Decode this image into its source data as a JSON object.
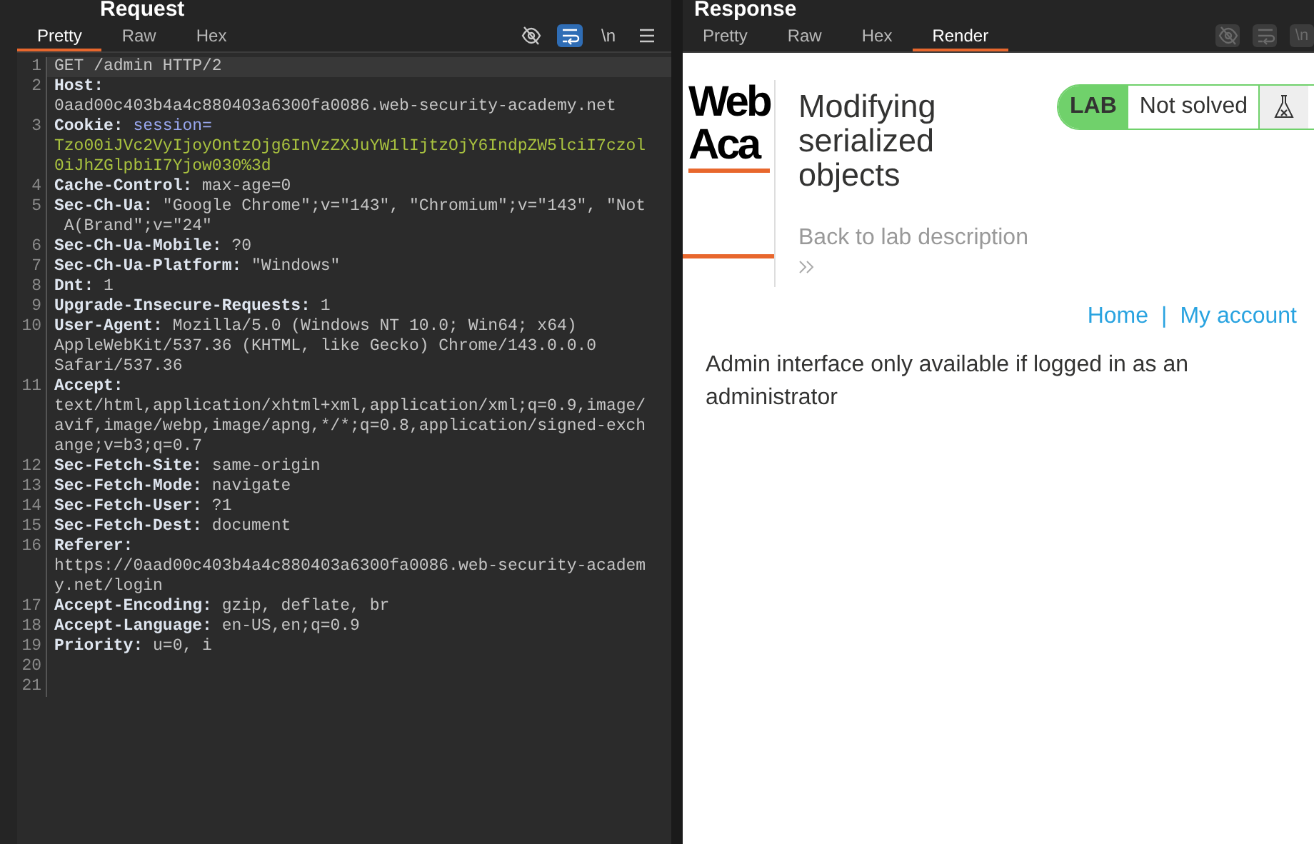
{
  "request": {
    "title": "Request",
    "tabs": [
      {
        "label": "Pretty",
        "selected": true
      },
      {
        "label": "Raw",
        "selected": false
      },
      {
        "label": "Hex",
        "selected": false
      }
    ],
    "toolbar": [
      {
        "kind": "hide",
        "on": false
      },
      {
        "kind": "wrap",
        "on": true
      },
      {
        "kind": "newline",
        "text": "\\n",
        "on": false
      },
      {
        "kind": "menu",
        "on": false
      }
    ],
    "lines": [
      {
        "number": "1",
        "current": true,
        "rows": [
          [
            {
              "kind": "value",
              "text": "GET /admin HTTP/2"
            }
          ]
        ]
      },
      {
        "number": "2",
        "current": false,
        "rows": [
          [
            {
              "kind": "name",
              "text": "Host:"
            }
          ],
          [
            {
              "kind": "value",
              "text": "0aad00c403b4a4c880403a6300fa0086.web-security-academy.net"
            }
          ]
        ]
      },
      {
        "number": "3",
        "current": false,
        "rows": [
          [
            {
              "kind": "name",
              "text": "Cookie: "
            },
            {
              "kind": "cookie_name",
              "text": "session="
            }
          ],
          [
            {
              "kind": "cookie_value",
              "text": "Tzo00iJVc2VyIjoyOntzOjg6InVzZXJuYW1lIjtzOjY6IndpZW5lciI7czol"
            }
          ],
          [
            {
              "kind": "cookie_value",
              "text": "0iJhZGlpbiI7Yjow030%3d"
            }
          ]
        ]
      },
      {
        "number": "4",
        "current": false,
        "rows": [
          [
            {
              "kind": "name",
              "text": "Cache-Control: "
            },
            {
              "kind": "value",
              "text": "max-age=0"
            }
          ]
        ]
      },
      {
        "number": "5",
        "current": false,
        "rows": [
          [
            {
              "kind": "name",
              "text": "Sec-Ch-Ua: "
            },
            {
              "kind": "value",
              "text": "\"Google Chrome\";v=\"143\", \"Chromium\";v=\"143\", \"Not"
            }
          ],
          [
            {
              "kind": "value",
              "text": " A(Brand\";v=\"24\""
            }
          ]
        ]
      },
      {
        "number": "6",
        "current": false,
        "rows": [
          [
            {
              "kind": "name",
              "text": "Sec-Ch-Ua-Mobile: "
            },
            {
              "kind": "value",
              "text": "?0"
            }
          ]
        ]
      },
      {
        "number": "7",
        "current": false,
        "rows": [
          [
            {
              "kind": "name",
              "text": "Sec-Ch-Ua-Platform: "
            },
            {
              "kind": "value",
              "text": "\"Windows\""
            }
          ]
        ]
      },
      {
        "number": "8",
        "current": false,
        "rows": [
          [
            {
              "kind": "name",
              "text": "Dnt: "
            },
            {
              "kind": "value",
              "text": "1"
            }
          ]
        ]
      },
      {
        "number": "9",
        "current": false,
        "rows": [
          [
            {
              "kind": "name",
              "text": "Upgrade-Insecure-Requests: "
            },
            {
              "kind": "value",
              "text": "1"
            }
          ]
        ]
      },
      {
        "number": "10",
        "current": false,
        "rows": [
          [
            {
              "kind": "name",
              "text": "User-Agent: "
            },
            {
              "kind": "value",
              "text": "Mozilla/5.0 (Windows NT 10.0; Win64; x64)"
            }
          ],
          [
            {
              "kind": "value",
              "text": "AppleWebKit/537.36 (KHTML, like Gecko) Chrome/143.0.0.0"
            }
          ],
          [
            {
              "kind": "value",
              "text": "Safari/537.36"
            }
          ]
        ]
      },
      {
        "number": "11",
        "current": false,
        "rows": [
          [
            {
              "kind": "name",
              "text": "Accept:"
            }
          ],
          [
            {
              "kind": "value",
              "text": "text/html,application/xhtml+xml,application/xml;q=0.9,image/"
            }
          ],
          [
            {
              "kind": "value",
              "text": "avif,image/webp,image/apng,*/*;q=0.8,application/signed-exch"
            }
          ],
          [
            {
              "kind": "value",
              "text": "ange;v=b3;q=0.7"
            }
          ]
        ]
      },
      {
        "number": "12",
        "current": false,
        "rows": [
          [
            {
              "kind": "name",
              "text": "Sec-Fetch-Site: "
            },
            {
              "kind": "value",
              "text": "same-origin"
            }
          ]
        ]
      },
      {
        "number": "13",
        "current": false,
        "rows": [
          [
            {
              "kind": "name",
              "text": "Sec-Fetch-Mode: "
            },
            {
              "kind": "value",
              "text": "navigate"
            }
          ]
        ]
      },
      {
        "number": "14",
        "current": false,
        "rows": [
          [
            {
              "kind": "name",
              "text": "Sec-Fetch-User: "
            },
            {
              "kind": "value",
              "text": "?1"
            }
          ]
        ]
      },
      {
        "number": "15",
        "current": false,
        "rows": [
          [
            {
              "kind": "name",
              "text": "Sec-Fetch-Dest: "
            },
            {
              "kind": "value",
              "text": "document"
            }
          ]
        ]
      },
      {
        "number": "16",
        "current": false,
        "rows": [
          [
            {
              "kind": "name",
              "text": "Referer:"
            }
          ],
          [
            {
              "kind": "value",
              "text": "https://0aad00c403b4a4c880403a6300fa0086.web-security-academ"
            }
          ],
          [
            {
              "kind": "value",
              "text": "y.net/login"
            }
          ]
        ]
      },
      {
        "number": "17",
        "current": false,
        "rows": [
          [
            {
              "kind": "name",
              "text": "Accept-Encoding: "
            },
            {
              "kind": "value",
              "text": "gzip, deflate, br"
            }
          ]
        ]
      },
      {
        "number": "18",
        "current": false,
        "rows": [
          [
            {
              "kind": "name",
              "text": "Accept-Language: "
            },
            {
              "kind": "value",
              "text": "en-US,en;q=0.9"
            }
          ]
        ]
      },
      {
        "number": "19",
        "current": false,
        "rows": [
          [
            {
              "kind": "name",
              "text": "Priority: "
            },
            {
              "kind": "value",
              "text": "u=0, i"
            }
          ]
        ]
      },
      {
        "number": "20",
        "current": false
      },
      {
        "number": "21",
        "current": false
      }
    ]
  },
  "response": {
    "title": "Response",
    "tabs": [
      {
        "label": "Pretty",
        "selected": false
      },
      {
        "label": "Raw",
        "selected": false
      },
      {
        "label": "Hex",
        "selected": false
      },
      {
        "label": "Render",
        "selected": true
      }
    ],
    "toolbar": [
      {
        "kind": "hide",
        "disabled": true
      },
      {
        "kind": "wrap",
        "disabled": true
      },
      {
        "kind": "newline",
        "text": "\\n",
        "disabled": true
      }
    ],
    "render": {
      "logo_lines": [
        "Web",
        "Aca"
      ],
      "title": "Modifying serialized objects",
      "badge": {
        "label": "LAB",
        "status": "Not solved",
        "solved": false
      },
      "back_link": "Back to lab description",
      "nav": [
        {
          "label": "Home"
        },
        {
          "label": "My account"
        }
      ],
      "nav_separator": "|",
      "message": "Admin interface only available if logged in as an administrator"
    }
  }
}
